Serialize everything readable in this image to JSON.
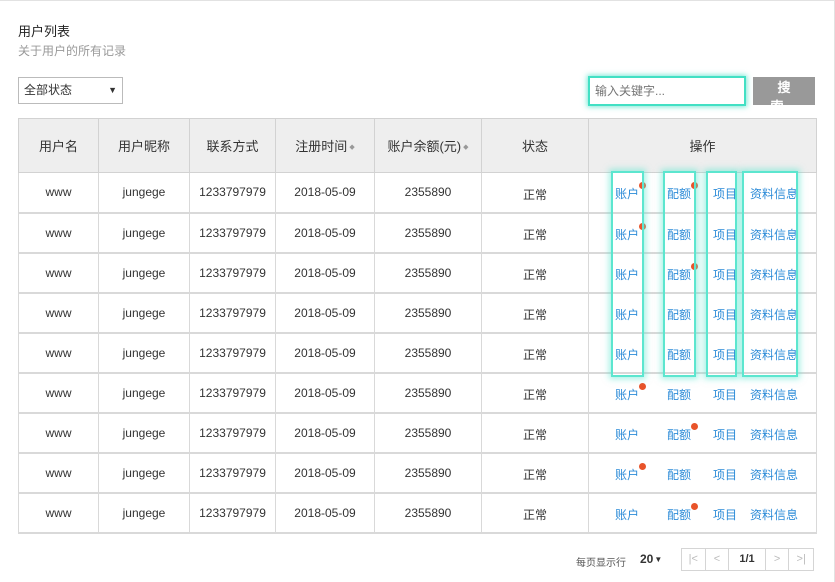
{
  "header": {
    "title": "用户列表",
    "subtitle": "关于用户的所有记录"
  },
  "filter": {
    "status_selected": "全部状态"
  },
  "search": {
    "placeholder": "输入关键字...",
    "button_label": "搜 索"
  },
  "table": {
    "columns": [
      "用户名",
      "用户昵称",
      "联系方式",
      "注册时间",
      "账户余额(元)",
      "状态",
      "操作"
    ],
    "sortable": [
      false,
      false,
      false,
      true,
      true,
      false,
      false
    ],
    "actions": [
      "账户",
      "配额",
      "项目",
      "资料信息"
    ],
    "rows": [
      {
        "username": "www",
        "nickname": "jungege",
        "contact": "1233797979",
        "registered": "2018-05-09",
        "balance": "2355890",
        "status": "正常",
        "badges": [
          true,
          true,
          false,
          false
        ]
      },
      {
        "username": "www",
        "nickname": "jungege",
        "contact": "1233797979",
        "registered": "2018-05-09",
        "balance": "2355890",
        "status": "正常",
        "badges": [
          true,
          false,
          false,
          false
        ]
      },
      {
        "username": "www",
        "nickname": "jungege",
        "contact": "1233797979",
        "registered": "2018-05-09",
        "balance": "2355890",
        "status": "正常",
        "badges": [
          false,
          true,
          false,
          false
        ]
      },
      {
        "username": "www",
        "nickname": "jungege",
        "contact": "1233797979",
        "registered": "2018-05-09",
        "balance": "2355890",
        "status": "正常",
        "badges": [
          false,
          false,
          false,
          false
        ]
      },
      {
        "username": "www",
        "nickname": "jungege",
        "contact": "1233797979",
        "registered": "2018-05-09",
        "balance": "2355890",
        "status": "正常",
        "badges": [
          false,
          false,
          false,
          false
        ]
      },
      {
        "username": "www",
        "nickname": "jungege",
        "contact": "1233797979",
        "registered": "2018-05-09",
        "balance": "2355890",
        "status": "正常",
        "badges": [
          true,
          false,
          false,
          false
        ]
      },
      {
        "username": "www",
        "nickname": "jungege",
        "contact": "1233797979",
        "registered": "2018-05-09",
        "balance": "2355890",
        "status": "正常",
        "badges": [
          false,
          true,
          false,
          false
        ]
      },
      {
        "username": "www",
        "nickname": "jungege",
        "contact": "1233797979",
        "registered": "2018-05-09",
        "balance": "2355890",
        "status": "正常",
        "badges": [
          true,
          false,
          false,
          false
        ]
      },
      {
        "username": "www",
        "nickname": "jungege",
        "contact": "1233797979",
        "registered": "2018-05-09",
        "balance": "2355890",
        "status": "正常",
        "badges": [
          false,
          true,
          false,
          false
        ]
      }
    ]
  },
  "pagination": {
    "per_page_label": "每页显示行",
    "per_page_value": "20",
    "current": "1/1"
  },
  "icons": {
    "sort": "sort-icon",
    "badge": "notification-dot-icon",
    "first": "first-page-icon",
    "prev": "prev-page-icon",
    "next": "next-page-icon",
    "last": "last-page-icon"
  },
  "colors": {
    "link": "#2d8cd8",
    "highlight": "#5ce6cf",
    "badge": "#e8532a",
    "search_button": "#999999",
    "header_bg": "#eeeeee"
  }
}
